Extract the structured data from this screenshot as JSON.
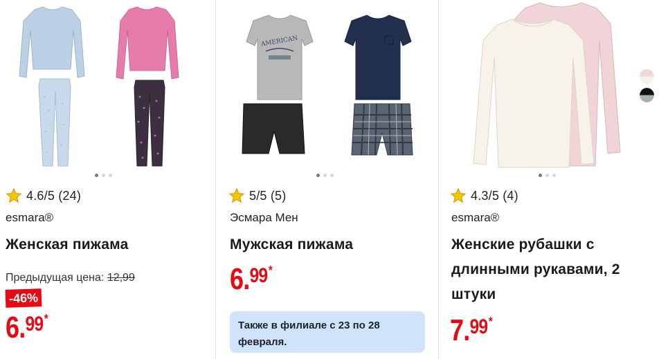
{
  "products": [
    {
      "image_carousel_dots": 3,
      "rating": "4.6/5 (24)",
      "brand": "esmara®",
      "title": "Женская пижама",
      "previous_price_label": "Предыдущая цена:",
      "previous_price": "12,99",
      "discount": "-46%",
      "price_int": "6.",
      "price_dec": "99",
      "price_mark": "*"
    },
    {
      "image_carousel_dots": 3,
      "rating": "5/5 (5)",
      "brand": "Эсмара Мен",
      "title": "Мужская пижама",
      "price_int": "6.",
      "price_dec": "99",
      "price_mark": "*",
      "availability_notice": "Также в филиале с 23 по 28 февраля.",
      "tshirt_print": "AMERICAN"
    },
    {
      "image_carousel_dots": 3,
      "rating": "4.3/5 (4)",
      "brand": "esmara®",
      "title": "Женские рубашки с длинными рукавами, 2 штуки",
      "price_int": "7.",
      "price_dec": "99",
      "price_mark": "*",
      "color_swatches": [
        "pink-white",
        "black-grey"
      ]
    }
  ],
  "colors": {
    "price_red": "#e60a14",
    "notice_blue": "#cfe3fb",
    "star_yellow": "#f7c600"
  }
}
